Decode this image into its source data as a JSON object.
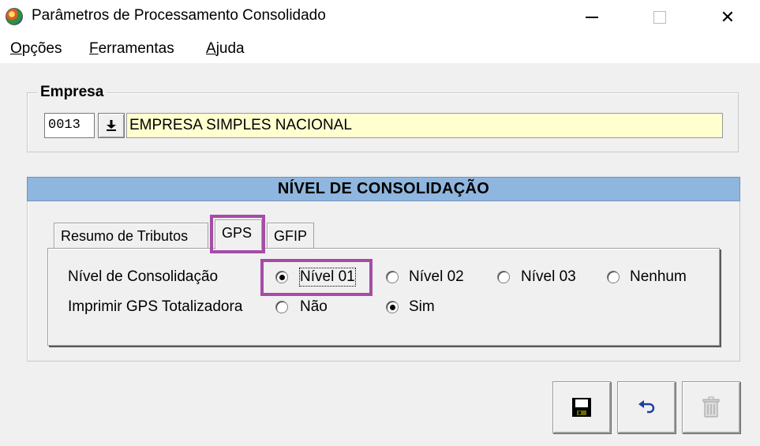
{
  "window": {
    "title": "Parâmetros de Processamento Consolidado",
    "minimize": "—",
    "close": "✕"
  },
  "menu": {
    "items": [
      {
        "accel": "O",
        "rest": "pções"
      },
      {
        "accel": "F",
        "rest": "erramentas"
      },
      {
        "accel": "A",
        "rest": "juda"
      }
    ]
  },
  "empresa": {
    "legend": "Empresa",
    "code": "0013",
    "name": "EMPRESA SIMPLES NACIONAL"
  },
  "panel": {
    "header": "NÍVEL DE CONSOLIDAÇÃO",
    "tabs": [
      "Resumo de Tributos",
      "GPS",
      "GFIP"
    ],
    "active_tab": "GPS"
  },
  "gps": {
    "nivel_label": "Nível de Consolidação",
    "nivel_options": [
      "Nível 01",
      "Nível 02",
      "Nível 03",
      "Nenhum"
    ],
    "nivel_selected": "Nível 01",
    "imprimir_label": "Imprimir GPS Totalizadora",
    "imprimir_options": [
      "Não",
      "Sim"
    ],
    "imprimir_selected": "Sim"
  },
  "colors": {
    "header_bg": "#8fb6de",
    "highlight": "#a64ca6",
    "name_field_bg": "#ffffd0"
  },
  "toolbar": {
    "icons": [
      "save-icon",
      "undo-icon",
      "delete-icon"
    ]
  }
}
